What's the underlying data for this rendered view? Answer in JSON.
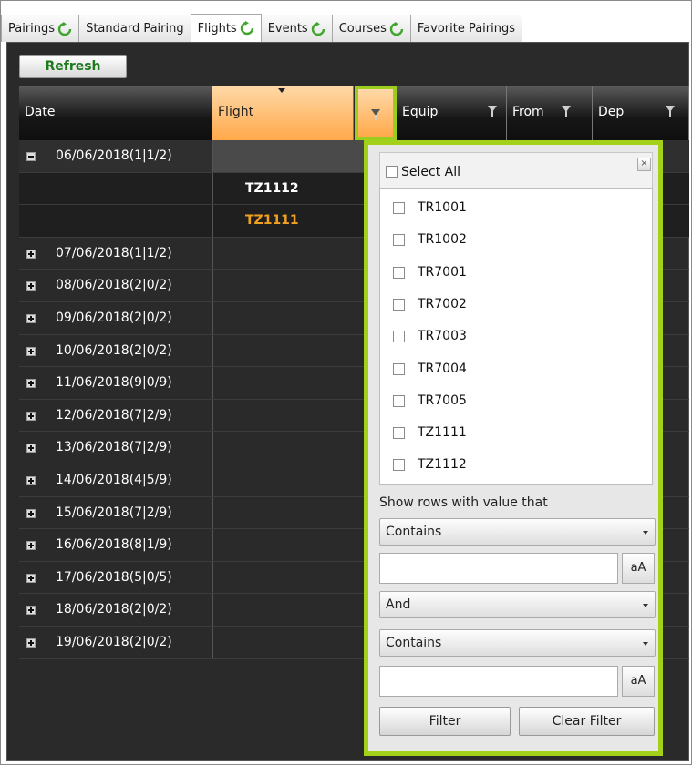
{
  "tabs": [
    {
      "label": "Pairings",
      "has_refresh": true,
      "active": false
    },
    {
      "label": "Standard Pairing",
      "has_refresh": false,
      "active": false
    },
    {
      "label": "Flights",
      "has_refresh": true,
      "active": true
    },
    {
      "label": "Events",
      "has_refresh": true,
      "active": false
    },
    {
      "label": "Courses",
      "has_refresh": true,
      "active": false
    },
    {
      "label": "Favorite Pairings",
      "has_refresh": false,
      "active": false
    }
  ],
  "toolbar": {
    "refresh_label": "Refresh"
  },
  "grid": {
    "columns": {
      "date": "Date",
      "flight": "Flight",
      "equip": "Equip",
      "from": "From",
      "dep": "Dep"
    },
    "open_group": {
      "label": "06/06/2018(1|1/2)",
      "flights": [
        "TZ1112",
        "TZ1111"
      ]
    },
    "groups": [
      "07/06/2018(1|1/2)",
      "08/06/2018(2|0/2)",
      "09/06/2018(2|0/2)",
      "10/06/2018(2|0/2)",
      "11/06/2018(9|0/9)",
      "12/06/2018(7|2/9)",
      "13/06/2018(7|2/9)",
      "14/06/2018(4|5/9)",
      "15/06/2018(7|2/9)",
      "16/06/2018(8|1/9)",
      "17/06/2018(5|0/5)",
      "18/06/2018(2|0/2)",
      "19/06/2018(2|0/2)"
    ]
  },
  "filter_popup": {
    "select_all_label": "Select All",
    "items": [
      "TR1001",
      "TR1002",
      "TR7001",
      "TR7002",
      "TR7003",
      "TR7004",
      "TR7005",
      "TZ1111",
      "TZ1112"
    ],
    "show_rows_label": "Show rows with value that",
    "operator1": "Contains",
    "logic": "And",
    "operator2": "Contains",
    "value1": "",
    "value2": "",
    "case_label": "aA",
    "filter_label": "Filter",
    "clear_label": "Clear Filter",
    "close_glyph": "×"
  },
  "colors": {
    "highlight_border": "#a3d11a",
    "accent_orange": "#ffa94a",
    "flight_alt_text": "#f0a020"
  }
}
